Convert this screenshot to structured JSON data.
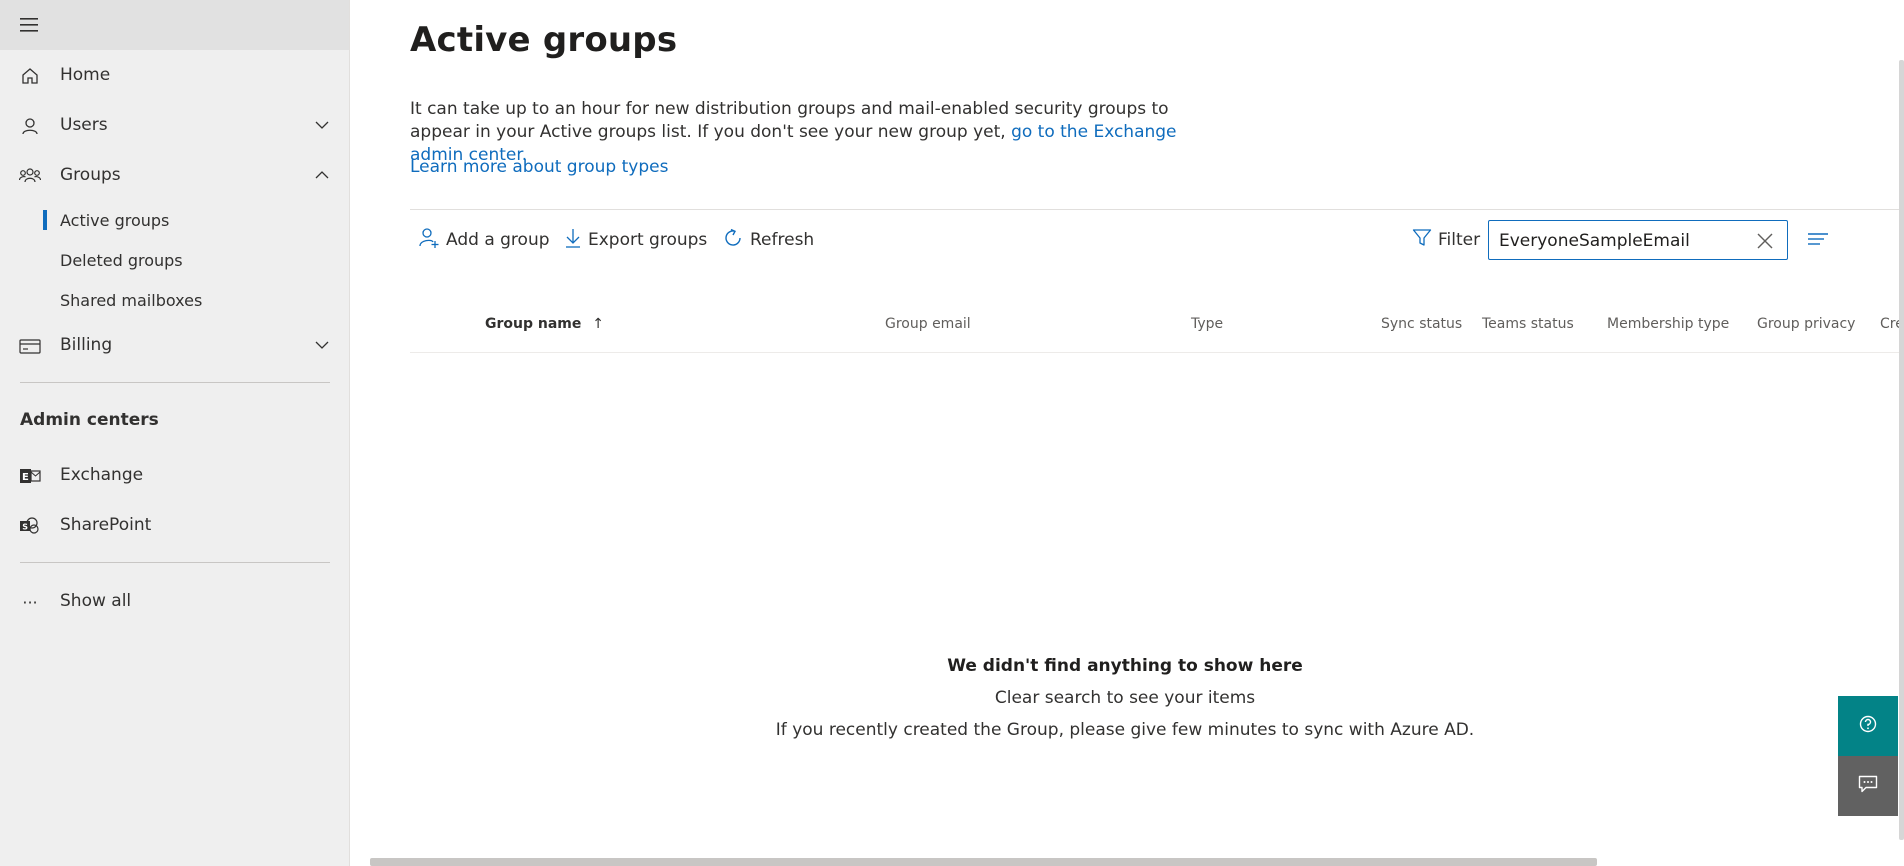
{
  "sidebar": {
    "home": "Home",
    "users": "Users",
    "groups": "Groups",
    "active_groups": "Active groups",
    "deleted_groups": "Deleted groups",
    "shared_mailboxes": "Shared mailboxes",
    "billing": "Billing",
    "admin_centers": "Admin centers",
    "exchange": "Exchange",
    "sharepoint": "SharePoint",
    "show_all": "Show all",
    "show_all_dots": "···"
  },
  "page": {
    "title": "Active groups",
    "desc_text": "It can take up to an hour for new distribution groups and mail-enabled security groups to appear in your Active groups list. If you don't see your new group yet, ",
    "desc_link": "go to the Exchange admin center.",
    "learn_more": "Learn more about group types"
  },
  "toolbar": {
    "add_group": "Add a group",
    "export_groups": "Export groups",
    "refresh": "Refresh",
    "filter": "Filter",
    "search_value": "EveryoneSampleEmail"
  },
  "table": {
    "columns": [
      "Group name",
      "Group email",
      "Type",
      "Sync status",
      "Teams status",
      "Membership type",
      "Group privacy",
      "Cre"
    ],
    "sort_indicator": "↑"
  },
  "empty_state": {
    "line1": "We didn't find anything to show here",
    "line2": "Clear search to see your items",
    "line3": "If you recently created the Group, please give few minutes to sync with Azure AD."
  },
  "colors": {
    "accent": "#0f6cbd",
    "help_button": "#038387",
    "feedback_button": "#616161",
    "sidebar_bg": "#efefef"
  },
  "icons": {
    "hamburger": "hamburger-icon",
    "home": "home-icon",
    "users": "person-icon",
    "groups": "people-icon",
    "billing": "credit-card-icon",
    "exchange": "exchange-icon",
    "sharepoint": "sharepoint-icon",
    "add_group": "add-person-icon",
    "export": "download-icon",
    "refresh": "refresh-icon",
    "filter": "filter-icon",
    "clear": "close-icon",
    "view": "list-view-icon",
    "help": "help-icon",
    "feedback": "feedback-icon"
  }
}
